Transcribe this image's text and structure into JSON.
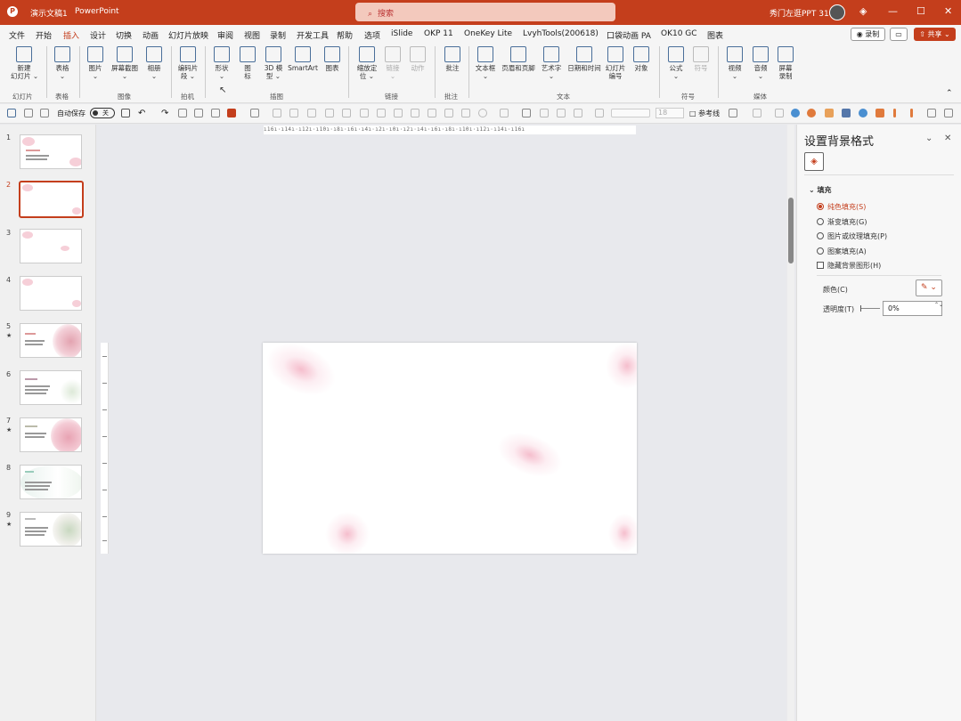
{
  "titlebar": {
    "doc": "演示文稿1",
    "app": "PowerPoint",
    "search": "搜索",
    "user": "秀门左逛PPT 318",
    "minimize": "—",
    "maximize": "☐",
    "close": "✕",
    "color": "#c43e1c"
  },
  "menu": {
    "items": [
      "文件",
      "开始",
      "插入",
      "设计",
      "切换",
      "动画",
      "幻灯片放映",
      "审阅",
      "视图",
      "录制",
      "开发工具",
      "帮助",
      "选项",
      "iSlide",
      "OKP 11",
      "OneKey Lite",
      "LvyhTools(200618)",
      "口袋动画 PA",
      "OK10 GC",
      "图表"
    ],
    "active": "插入",
    "record": "◉ 录制",
    "comment": "▭",
    "share": "⇧ 共享 ⌄"
  },
  "ribbon": {
    "items": [
      {
        "label": "新建\n幻灯片 ⌄"
      },
      {
        "label": "表格\n⌄"
      },
      {
        "label": "图片\n⌄"
      },
      {
        "label": "屏幕截图\n⌄"
      },
      {
        "label": "相册\n⌄"
      },
      {
        "label": "编码片\n段 ⌄"
      },
      {
        "label": "形状\n⌄"
      },
      {
        "label": "图\n标"
      },
      {
        "label": "3D 模\n型 ⌄"
      },
      {
        "label": "SmartArt"
      },
      {
        "label": "图表"
      },
      {
        "label": "缩放定\n位 ⌄"
      },
      {
        "label": "链接\n⌄"
      },
      {
        "label": "动作"
      },
      {
        "label": "批注"
      },
      {
        "label": "文本框\n⌄"
      },
      {
        "label": "页眉和页脚"
      },
      {
        "label": "艺术字\n⌄"
      },
      {
        "label": "日期和时间"
      },
      {
        "label": "幻灯片\n编号"
      },
      {
        "label": "对象"
      },
      {
        "label": "公式\n⌄"
      },
      {
        "label": "符号"
      },
      {
        "label": "视频\n⌄"
      },
      {
        "label": "音频\n⌄"
      },
      {
        "label": "屏幕\n录制"
      }
    ],
    "groups": [
      "幻灯片",
      "表格",
      "图像",
      "拍机",
      "插图",
      "链接",
      "批注",
      "文本",
      "符号",
      "媒体"
    ],
    "collapse": "⌃"
  },
  "qat": {
    "autosave": "自动保存",
    "toggle": "关",
    "font_size": "18",
    "equal_line": "□ 参考线"
  },
  "slides": {
    "numbers": [
      "1",
      "2",
      "3",
      "4",
      "5",
      "6",
      "7",
      "8",
      "9"
    ],
    "star": "★",
    "selected": 2
  },
  "ruler": {
    "text": "ı16ı·ı14ı·ı12ı·ı10ı·ı8ı·ı6ı·ı4ı·ı2ı·ı0ı·ı2ı·ı4ı·ı6ı·ı8ı·ı10ı·ı12ı·ı14ı·ı16ı"
  },
  "format_panel": {
    "title": "设置背景格式",
    "collapse": "⌄",
    "close": "✕",
    "tab_icon": "fill-bucket-icon",
    "section": "⌄ 填充",
    "options": [
      {
        "label": "纯色填充(S)",
        "selected": true
      },
      {
        "label": "渐变填充(G)",
        "selected": false
      },
      {
        "label": "图片或纹理填充(P)",
        "selected": false
      },
      {
        "label": "图案填充(A)",
        "selected": false
      }
    ],
    "hide_bg": "隐藏背景图形(H)",
    "color_label": "颜色(C)",
    "color_btn": "✎ ⌄",
    "transparency_label": "透明度(T)",
    "transparency_value": "0%",
    "spinner": "⌃⌄"
  }
}
